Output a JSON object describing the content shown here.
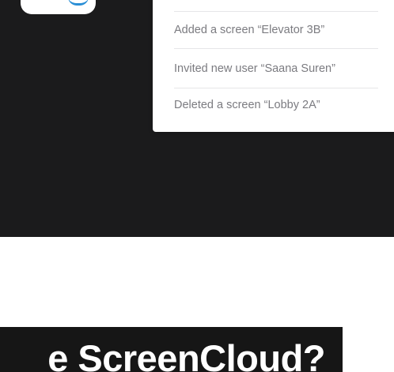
{
  "activity_log": {
    "items": [
      "Added a screen “Elevator 3B”",
      "Invited new user “Saana Suren”",
      "Deleted a screen “Lobby 2A”"
    ]
  },
  "section_heading": {
    "text": "e ScreenCloud?"
  },
  "colors": {
    "dark_band": "#1b1b1c",
    "card": "#ffffff",
    "activity_text": "#7b7b80",
    "heading_banner": "#161616",
    "heading_text": "#ffffff",
    "icon_accent": "#2a8fd6"
  }
}
